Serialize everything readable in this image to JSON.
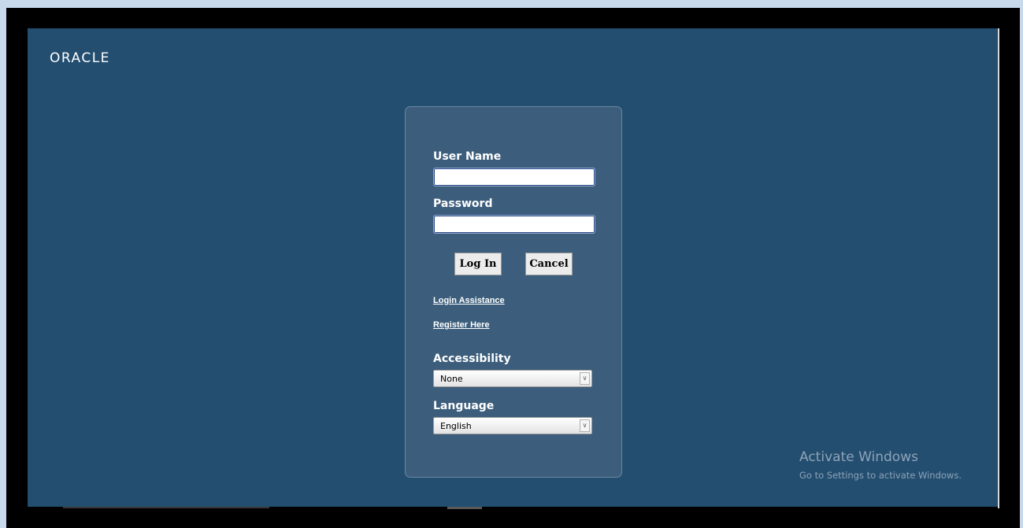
{
  "brand": {
    "logo_text": "ORACLE"
  },
  "login_form": {
    "username_label": "User Name",
    "username_value": "",
    "password_label": "Password",
    "password_value": "",
    "login_button": "Log In",
    "cancel_button": "Cancel",
    "login_assistance_link": "Login Assistance",
    "register_link": "Register Here",
    "accessibility_label": "Accessibility",
    "accessibility_value": "None",
    "language_label": "Language",
    "language_value": "English"
  },
  "watermark": {
    "title": "Activate Windows",
    "subtitle": "Go to Settings to activate Windows."
  },
  "colors": {
    "page_background": "#234e70",
    "panel_background": "#3c5e7c",
    "label_text": "#ffffff"
  },
  "icons": {
    "select_arrow": "chevron-down-icon"
  }
}
